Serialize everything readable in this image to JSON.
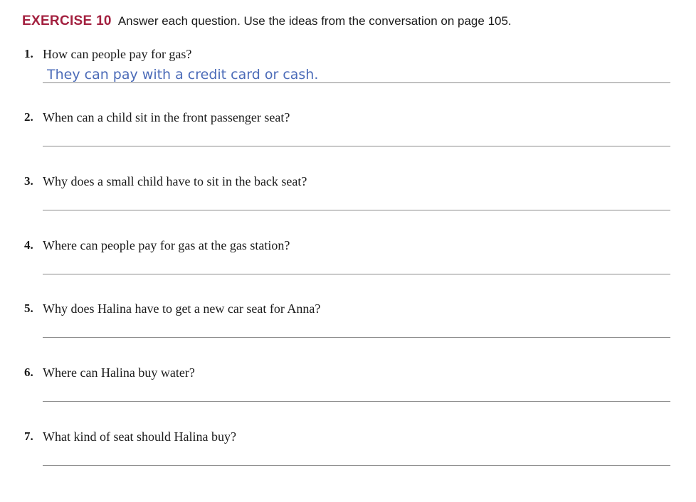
{
  "exercise": {
    "label": "EXERCISE 10",
    "instructions": "Answer each question. Use the ideas from the conversation on page 105."
  },
  "questions": [
    {
      "number": "1.",
      "text": "How can people pay for gas?",
      "answer": "They can pay with a credit card or cash."
    },
    {
      "number": "2.",
      "text": "When can a child sit in the front passenger seat?",
      "answer": ""
    },
    {
      "number": "3.",
      "text": "Why does a small child have to sit in the back seat?",
      "answer": ""
    },
    {
      "number": "4.",
      "text": "Where can people pay for gas at the gas station?",
      "answer": ""
    },
    {
      "number": "5.",
      "text": "Why does Halina have to get a new car seat for Anna?",
      "answer": ""
    },
    {
      "number": "6.",
      "text": "Where can Halina buy water?",
      "answer": ""
    },
    {
      "number": "7.",
      "text": "What kind of seat should Halina buy?",
      "answer": ""
    }
  ],
  "colors": {
    "exercise_label": "#a3203f",
    "answer_text": "#4b6bb8",
    "answer_line": "#8a8a8a"
  }
}
